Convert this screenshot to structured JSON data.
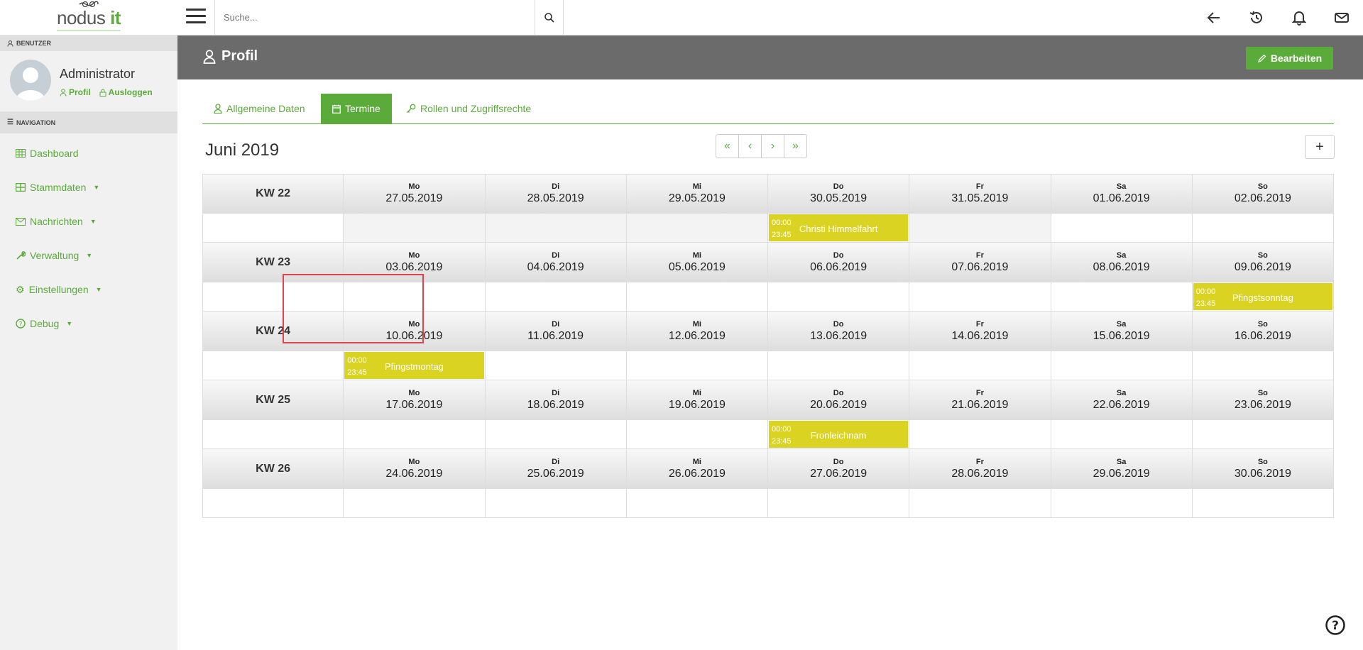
{
  "app": {
    "logo_text": "nodus",
    "logo_accent": "it"
  },
  "search": {
    "placeholder": "Suche..."
  },
  "sidebar": {
    "user_section_label": "BENUTZER",
    "user_name": "Administrator",
    "profile_link": "Profil",
    "logout_link": "Ausloggen",
    "nav_section_label": "NAVIGATION",
    "items": [
      {
        "label": "Dashboard",
        "icon": "table-icon",
        "has_caret": false
      },
      {
        "label": "Stammdaten",
        "icon": "grid-icon",
        "has_caret": true
      },
      {
        "label": "Nachrichten",
        "icon": "envelope-icon",
        "has_caret": true
      },
      {
        "label": "Verwaltung",
        "icon": "wrench-icon",
        "has_caret": true
      },
      {
        "label": "Einstellungen",
        "icon": "gears-icon",
        "has_caret": true
      },
      {
        "label": "Debug",
        "icon": "question-circle-icon",
        "has_caret": true
      }
    ]
  },
  "header": {
    "title": "Profil",
    "edit_label": "Bearbeiten"
  },
  "tabs": [
    {
      "label": "Allgemeine Daten",
      "icon": "user-icon",
      "active": false
    },
    {
      "label": "Termine",
      "icon": "calendar-icon",
      "active": true
    },
    {
      "label": "Rollen und Zugriffsrechte",
      "icon": "key-icon",
      "active": false
    }
  ],
  "calendar": {
    "month_title": "Juni 2019",
    "pager": [
      "«",
      "‹",
      "›",
      "»"
    ],
    "add_label": "+",
    "weeks": [
      {
        "kw": "KW 22",
        "days": [
          {
            "name": "Mo",
            "date": "27.05.2019",
            "grey": true
          },
          {
            "name": "Di",
            "date": "28.05.2019",
            "grey": true
          },
          {
            "name": "Mi",
            "date": "29.05.2019",
            "grey": true
          },
          {
            "name": "Do",
            "date": "30.05.2019",
            "grey": true,
            "event": {
              "start": "00:00",
              "end": "23:45",
              "title": "Christi Himmelfahrt"
            }
          },
          {
            "name": "Fr",
            "date": "31.05.2019",
            "grey": true
          },
          {
            "name": "Sa",
            "date": "01.06.2019",
            "grey": false
          },
          {
            "name": "So",
            "date": "02.06.2019",
            "grey": false
          }
        ]
      },
      {
        "kw": "KW 23",
        "days": [
          {
            "name": "Mo",
            "date": "03.06.2019"
          },
          {
            "name": "Di",
            "date": "04.06.2019"
          },
          {
            "name": "Mi",
            "date": "05.06.2019"
          },
          {
            "name": "Do",
            "date": "06.06.2019"
          },
          {
            "name": "Fr",
            "date": "07.06.2019"
          },
          {
            "name": "Sa",
            "date": "08.06.2019"
          },
          {
            "name": "So",
            "date": "09.06.2019",
            "event": {
              "start": "00:00",
              "end": "23:45",
              "title": "Pfingstsonntag"
            }
          }
        ]
      },
      {
        "kw": "KW 24",
        "days": [
          {
            "name": "Mo",
            "date": "10.06.2019",
            "event": {
              "start": "00:00",
              "end": "23:45",
              "title": "Pfingstmontag"
            }
          },
          {
            "name": "Di",
            "date": "11.06.2019"
          },
          {
            "name": "Mi",
            "date": "12.06.2019"
          },
          {
            "name": "Do",
            "date": "13.06.2019"
          },
          {
            "name": "Fr",
            "date": "14.06.2019"
          },
          {
            "name": "Sa",
            "date": "15.06.2019"
          },
          {
            "name": "So",
            "date": "16.06.2019"
          }
        ]
      },
      {
        "kw": "KW 25",
        "days": [
          {
            "name": "Mo",
            "date": "17.06.2019"
          },
          {
            "name": "Di",
            "date": "18.06.2019"
          },
          {
            "name": "Mi",
            "date": "19.06.2019"
          },
          {
            "name": "Do",
            "date": "20.06.2019",
            "event": {
              "start": "00:00",
              "end": "23:45",
              "title": "Fronleichnam"
            }
          },
          {
            "name": "Fr",
            "date": "21.06.2019"
          },
          {
            "name": "Sa",
            "date": "22.06.2019"
          },
          {
            "name": "So",
            "date": "23.06.2019"
          }
        ]
      },
      {
        "kw": "KW 26",
        "days": [
          {
            "name": "Mo",
            "date": "24.06.2019"
          },
          {
            "name": "Di",
            "date": "25.06.2019",
            "selected": true
          },
          {
            "name": "Mi",
            "date": "26.06.2019"
          },
          {
            "name": "Do",
            "date": "27.06.2019"
          },
          {
            "name": "Fr",
            "date": "28.06.2019"
          },
          {
            "name": "Sa",
            "date": "29.06.2019"
          },
          {
            "name": "So",
            "date": "30.06.2019"
          }
        ]
      }
    ]
  },
  "colors": {
    "accent": "#5bab3a",
    "header_bg": "#6b6b6b",
    "event": "#dad321",
    "selection": "#e0434b"
  }
}
